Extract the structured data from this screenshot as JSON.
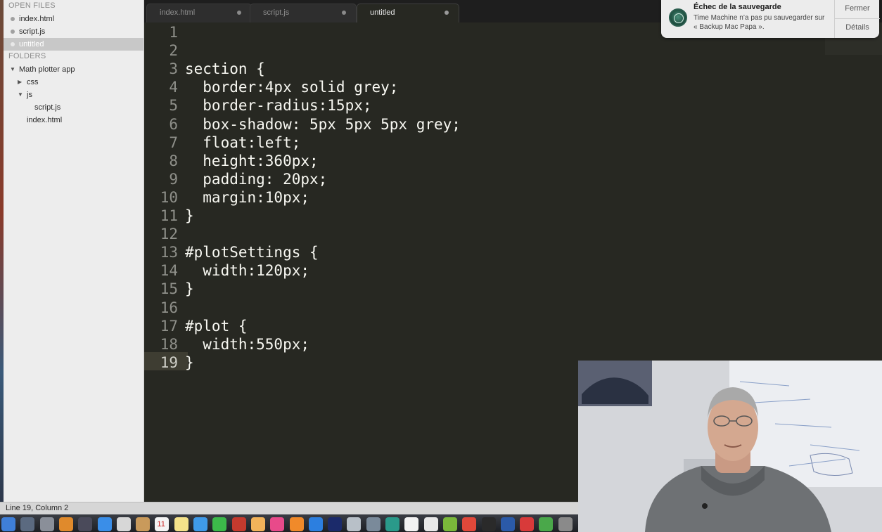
{
  "sidebar": {
    "open_files_heading": "OPEN FILES",
    "open_files": [
      {
        "label": "index.html"
      },
      {
        "label": "script.js"
      },
      {
        "label": "untitled",
        "selected": true
      }
    ],
    "folders_heading": "FOLDERS",
    "tree": {
      "root": "Math plotter app",
      "css": "css",
      "js": "js",
      "script": "script.js",
      "index": "index.html"
    }
  },
  "tabs": [
    {
      "label": "index.html"
    },
    {
      "label": "script.js"
    },
    {
      "label": "untitled",
      "active": true
    }
  ],
  "editor": {
    "line_numbers": [
      "1",
      "2",
      "3",
      "4",
      "5",
      "6",
      "7",
      "8",
      "9",
      "10",
      "11",
      "12",
      "13",
      "14",
      "15",
      "16",
      "17",
      "18",
      "19"
    ],
    "current_line": 19,
    "lines": [
      "",
      "",
      "section {",
      "  border:4px solid grey;",
      "  border-radius:15px;",
      "  box-shadow: 5px 5px 5px grey;",
      "  float:left;",
      "  height:360px;",
      "  padding: 20px;",
      "  margin:10px;",
      "}",
      "",
      "#plotSettings {",
      "  width:120px;",
      "}",
      "",
      "#plot {",
      "  width:550px;",
      "}"
    ]
  },
  "status_bar": {
    "text": "Line 19, Column 2"
  },
  "notification": {
    "title": "Échec de la sauvegarde",
    "body": "Time Machine n’a pas pu sauvegarder sur « Backup Mac Papa ».",
    "close_label": "Fermer",
    "details_label": "Détails",
    "icon": "time-machine-icon"
  },
  "dock": {
    "calendar_day": "11",
    "icons": [
      "finder-icon",
      "launchpad-icon",
      "rocket-icon",
      "sublime-icon",
      "mission-control-icon",
      "safari-icon",
      "apps-grid-icon",
      "contacts-icon",
      "calendar-icon",
      "notes-icon",
      "messages-icon",
      "facetime-icon",
      "photo-booth-icon",
      "photos-icon",
      "itunes-icon",
      "ibooks-icon",
      "app-store-icon",
      "photoshop-icon",
      "preview-icon",
      "utilities-icon",
      "chrome-canary-icon",
      "piano-icon",
      "textedit-icon",
      "android-icon",
      "chrome-icon",
      "terminal-icon",
      "word-icon",
      "scrivener-icon",
      "android-studio-icon",
      "settings-icon"
    ]
  },
  "colors": {
    "editor_bg": "#272822",
    "sidebar_bg": "#ededed",
    "code_text": "#f8f8f2",
    "gutter_text": "#8f908a"
  }
}
